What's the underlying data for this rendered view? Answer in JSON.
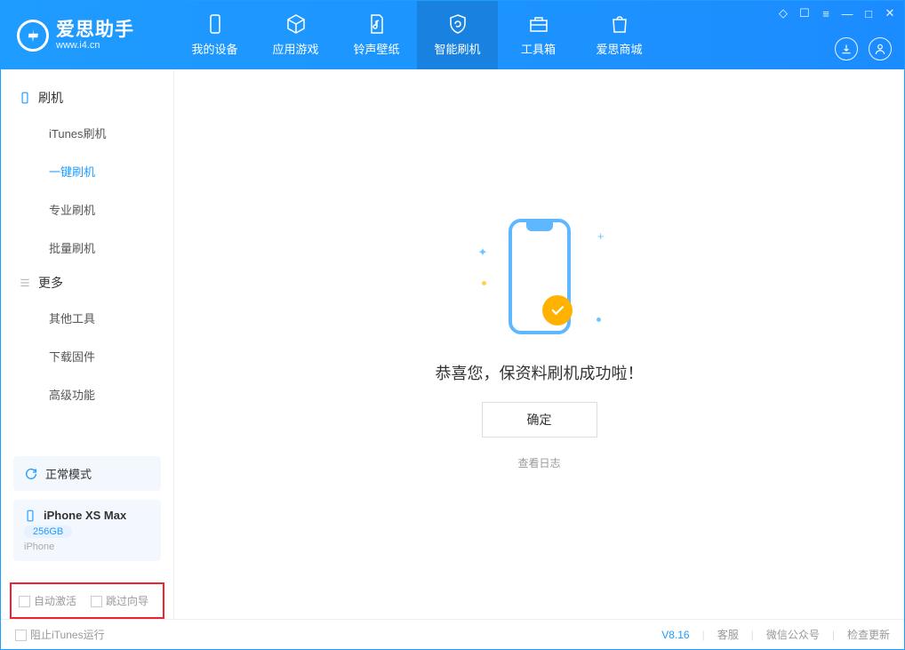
{
  "app": {
    "name": "爱思助手",
    "url": "www.i4.cn"
  },
  "nav": {
    "tabs": [
      {
        "label": "我的设备"
      },
      {
        "label": "应用游戏"
      },
      {
        "label": "铃声壁纸"
      },
      {
        "label": "智能刷机"
      },
      {
        "label": "工具箱"
      },
      {
        "label": "爱思商城"
      }
    ]
  },
  "sidebar": {
    "section_flash": "刷机",
    "items_flash": [
      {
        "label": "iTunes刷机"
      },
      {
        "label": "一键刷机"
      },
      {
        "label": "专业刷机"
      },
      {
        "label": "批量刷机"
      }
    ],
    "section_more": "更多",
    "items_more": [
      {
        "label": "其他工具"
      },
      {
        "label": "下载固件"
      },
      {
        "label": "高级功能"
      }
    ],
    "mode_label": "正常模式",
    "device": {
      "name": "iPhone XS Max",
      "capacity": "256GB",
      "type": "iPhone"
    },
    "opt_auto_activate": "自动激活",
    "opt_skip_guide": "跳过向导"
  },
  "main": {
    "success_msg": "恭喜您，保资料刷机成功啦！",
    "ok_label": "确定",
    "view_log": "查看日志"
  },
  "statusbar": {
    "block_itunes": "阻止iTunes运行",
    "version": "V8.16",
    "support": "客服",
    "wechat": "微信公众号",
    "check_update": "检查更新"
  }
}
